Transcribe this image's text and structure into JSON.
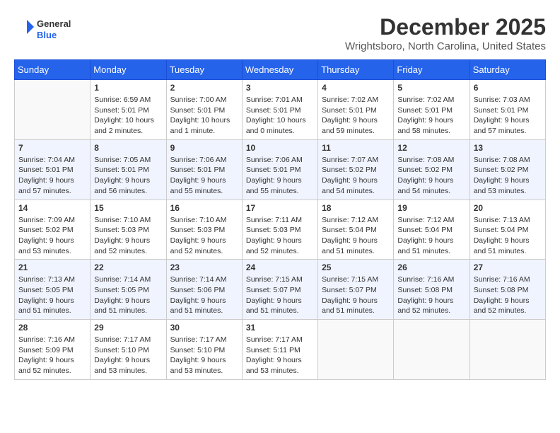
{
  "header": {
    "logo": {
      "general": "General",
      "blue": "Blue"
    },
    "title": "December 2025",
    "subtitle": "Wrightsboro, North Carolina, United States"
  },
  "days_of_week": [
    "Sunday",
    "Monday",
    "Tuesday",
    "Wednesday",
    "Thursday",
    "Friday",
    "Saturday"
  ],
  "weeks": [
    [
      {
        "day": "",
        "info": ""
      },
      {
        "day": "1",
        "info": "Sunrise: 6:59 AM\nSunset: 5:01 PM\nDaylight: 10 hours\nand 2 minutes."
      },
      {
        "day": "2",
        "info": "Sunrise: 7:00 AM\nSunset: 5:01 PM\nDaylight: 10 hours\nand 1 minute."
      },
      {
        "day": "3",
        "info": "Sunrise: 7:01 AM\nSunset: 5:01 PM\nDaylight: 10 hours\nand 0 minutes."
      },
      {
        "day": "4",
        "info": "Sunrise: 7:02 AM\nSunset: 5:01 PM\nDaylight: 9 hours\nand 59 minutes."
      },
      {
        "day": "5",
        "info": "Sunrise: 7:02 AM\nSunset: 5:01 PM\nDaylight: 9 hours\nand 58 minutes."
      },
      {
        "day": "6",
        "info": "Sunrise: 7:03 AM\nSunset: 5:01 PM\nDaylight: 9 hours\nand 57 minutes."
      }
    ],
    [
      {
        "day": "7",
        "info": "Sunrise: 7:04 AM\nSunset: 5:01 PM\nDaylight: 9 hours\nand 57 minutes."
      },
      {
        "day": "8",
        "info": "Sunrise: 7:05 AM\nSunset: 5:01 PM\nDaylight: 9 hours\nand 56 minutes."
      },
      {
        "day": "9",
        "info": "Sunrise: 7:06 AM\nSunset: 5:01 PM\nDaylight: 9 hours\nand 55 minutes."
      },
      {
        "day": "10",
        "info": "Sunrise: 7:06 AM\nSunset: 5:01 PM\nDaylight: 9 hours\nand 55 minutes."
      },
      {
        "day": "11",
        "info": "Sunrise: 7:07 AM\nSunset: 5:02 PM\nDaylight: 9 hours\nand 54 minutes."
      },
      {
        "day": "12",
        "info": "Sunrise: 7:08 AM\nSunset: 5:02 PM\nDaylight: 9 hours\nand 54 minutes."
      },
      {
        "day": "13",
        "info": "Sunrise: 7:08 AM\nSunset: 5:02 PM\nDaylight: 9 hours\nand 53 minutes."
      }
    ],
    [
      {
        "day": "14",
        "info": "Sunrise: 7:09 AM\nSunset: 5:02 PM\nDaylight: 9 hours\nand 53 minutes."
      },
      {
        "day": "15",
        "info": "Sunrise: 7:10 AM\nSunset: 5:03 PM\nDaylight: 9 hours\nand 52 minutes."
      },
      {
        "day": "16",
        "info": "Sunrise: 7:10 AM\nSunset: 5:03 PM\nDaylight: 9 hours\nand 52 minutes."
      },
      {
        "day": "17",
        "info": "Sunrise: 7:11 AM\nSunset: 5:03 PM\nDaylight: 9 hours\nand 52 minutes."
      },
      {
        "day": "18",
        "info": "Sunrise: 7:12 AM\nSunset: 5:04 PM\nDaylight: 9 hours\nand 51 minutes."
      },
      {
        "day": "19",
        "info": "Sunrise: 7:12 AM\nSunset: 5:04 PM\nDaylight: 9 hours\nand 51 minutes."
      },
      {
        "day": "20",
        "info": "Sunrise: 7:13 AM\nSunset: 5:04 PM\nDaylight: 9 hours\nand 51 minutes."
      }
    ],
    [
      {
        "day": "21",
        "info": "Sunrise: 7:13 AM\nSunset: 5:05 PM\nDaylight: 9 hours\nand 51 minutes."
      },
      {
        "day": "22",
        "info": "Sunrise: 7:14 AM\nSunset: 5:05 PM\nDaylight: 9 hours\nand 51 minutes."
      },
      {
        "day": "23",
        "info": "Sunrise: 7:14 AM\nSunset: 5:06 PM\nDaylight: 9 hours\nand 51 minutes."
      },
      {
        "day": "24",
        "info": "Sunrise: 7:15 AM\nSunset: 5:07 PM\nDaylight: 9 hours\nand 51 minutes."
      },
      {
        "day": "25",
        "info": "Sunrise: 7:15 AM\nSunset: 5:07 PM\nDaylight: 9 hours\nand 51 minutes."
      },
      {
        "day": "26",
        "info": "Sunrise: 7:16 AM\nSunset: 5:08 PM\nDaylight: 9 hours\nand 52 minutes."
      },
      {
        "day": "27",
        "info": "Sunrise: 7:16 AM\nSunset: 5:08 PM\nDaylight: 9 hours\nand 52 minutes."
      }
    ],
    [
      {
        "day": "28",
        "info": "Sunrise: 7:16 AM\nSunset: 5:09 PM\nDaylight: 9 hours\nand 52 minutes."
      },
      {
        "day": "29",
        "info": "Sunrise: 7:17 AM\nSunset: 5:10 PM\nDaylight: 9 hours\nand 53 minutes."
      },
      {
        "day": "30",
        "info": "Sunrise: 7:17 AM\nSunset: 5:10 PM\nDaylight: 9 hours\nand 53 minutes."
      },
      {
        "day": "31",
        "info": "Sunrise: 7:17 AM\nSunset: 5:11 PM\nDaylight: 9 hours\nand 53 minutes."
      },
      {
        "day": "",
        "info": ""
      },
      {
        "day": "",
        "info": ""
      },
      {
        "day": "",
        "info": ""
      }
    ]
  ]
}
